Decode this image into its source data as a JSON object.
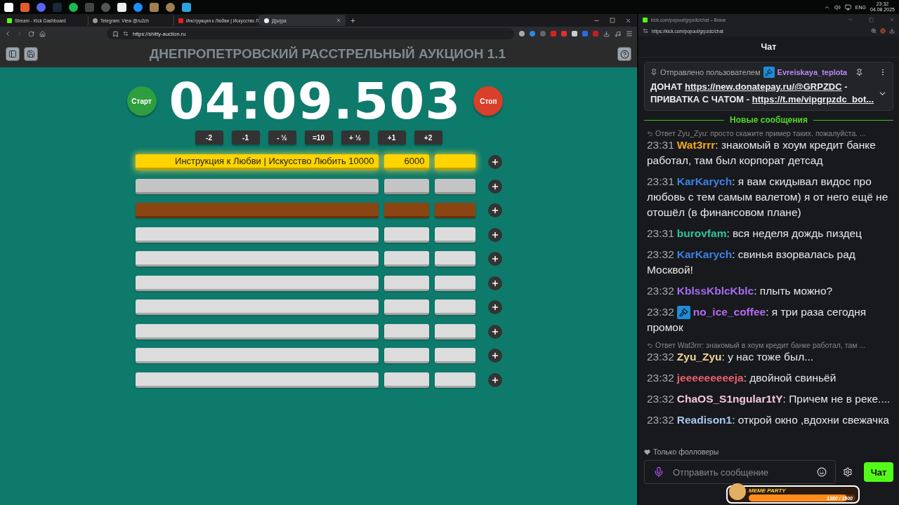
{
  "taskbar": {
    "language": "ENG",
    "time": "23:32",
    "date": "04.08.2025"
  },
  "browser": {
    "tabs": [
      {
        "label": "Stream - Kick Dashboard",
        "selected": false
      },
      {
        "label": "Telegram: View @ru2ch",
        "selected": false
      },
      {
        "label": "Инструкция к Любви | Искусство Л",
        "selected": false
      },
      {
        "label": "Д(ы)ра",
        "selected": true
      }
    ],
    "url": "https://shitty-auction.ru"
  },
  "auction": {
    "title": "ДНЕПРОПЕТРОВСКИЙ РАССТРЕЛЬНЫЙ АУКЦИОН 1.1",
    "timer": "04:09.503",
    "start_label": "Старт",
    "stop_label": "Стоп",
    "adjust_buttons": [
      "-2",
      "-1",
      "- ½",
      "=10",
      "+ ½",
      "+1",
      "+2"
    ],
    "lots": [
      {
        "color": "#ffd400",
        "leading": true,
        "name": "Инструкция к Любви | Искусство Любить 10000",
        "amount": "6000"
      },
      {
        "color": "#c4c4c4",
        "leading": false
      },
      {
        "color": "#8b4513",
        "leading": false
      },
      {
        "color": "#dcdcdc",
        "leading": false
      },
      {
        "color": "#dcdcdc",
        "leading": false
      },
      {
        "color": "#dcdcdc",
        "leading": false
      },
      {
        "color": "#dcdcdc",
        "leading": false
      },
      {
        "color": "#dcdcdc",
        "leading": false
      },
      {
        "color": "#dcdcdc",
        "leading": false
      },
      {
        "color": "#dcdcdc",
        "leading": false
      }
    ]
  },
  "chat_window": {
    "title": "kick.com/popout/grpzdc/chat – Brave",
    "url": "https://kick.com/popout/grpzdc/chat"
  },
  "chat": {
    "header": "Чат",
    "pinned": {
      "label": "Отправлено пользователем",
      "user": "Evreiskaya_teplota",
      "text_1": "ДОНАТ",
      "link_1": "https://new.donatepay.ru/@GRPZDC",
      "text_2": "- ПРИВАТКА С ЧАТОМ -",
      "link_2": "https://t.me/vipgrpzdc_bot..."
    },
    "divider": "Новые сообщения",
    "name_separator": ":",
    "messages": [
      {
        "reply": "Ответ Zyu_Zyu: просто скажите пример таких. пожалуйста. ...",
        "time": "23:31",
        "user": "Wat3rrr",
        "color": "#f5a623",
        "badge": false,
        "text": "знакомый в хоум кредит банке работал, там был корпорат детсад"
      },
      {
        "time": "23:31",
        "user": "KarKarych",
        "color": "#3b82e6",
        "badge": false,
        "text": "я вам скидывал видос про любовь с тем самым валетом) я от него ещё не отошёл (в финансовом плане)"
      },
      {
        "time": "23:31",
        "user": "burovfam",
        "color": "#2ec4a0",
        "badge": false,
        "text": "вся неделя дождь пиздец"
      },
      {
        "time": "23:32",
        "user": "KarKarych",
        "color": "#3b82e6",
        "badge": false,
        "text": "свинья взорвалась рад Москвой!"
      },
      {
        "time": "23:32",
        "user": "KblssKblcKblc",
        "color": "#a66cf0",
        "badge": false,
        "text": "плыть можно?"
      },
      {
        "time": "23:32",
        "user": "no_ice_coffee",
        "color": "#b36cf2",
        "badge": true,
        "text": "я три раза сегодня промок"
      },
      {
        "reply": "Ответ Wat3rrr: знакомый в хоум кредит банке работал, там ...",
        "time": "23:32",
        "user": "Zyu_Zyu",
        "color": "#f2d49a",
        "badge": false,
        "text": "у нас тоже был..."
      },
      {
        "time": "23:32",
        "user": "jeeeeeeeeeja",
        "color": "#e86070",
        "badge": false,
        "text": "двойной свиньёй"
      },
      {
        "time": "23:32",
        "user": "ChaOS_S1ngular1tY",
        "color": "#f4c8d8",
        "badge": false,
        "text": "Причем не в реке...."
      },
      {
        "time": "23:32",
        "user": "Readison1",
        "color": "#a8c8f4",
        "badge": false,
        "text": "открой окно ,вдохни свежачка"
      }
    ],
    "followers_only": "Только фолловеры",
    "input": {
      "placeholder": "Отправить сообщение"
    },
    "send_label": "Чат"
  },
  "overlay": {
    "title": "MEME PARTY",
    "progress": "1380 / 1500",
    "level": 0.92
  }
}
